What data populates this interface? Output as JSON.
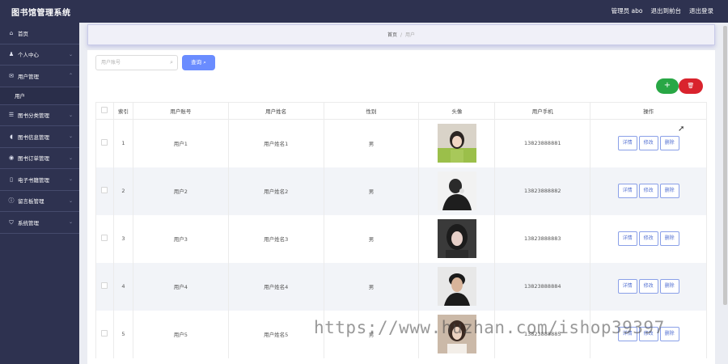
{
  "app": {
    "title": "图书馆管理系统"
  },
  "topbar": {
    "user": "管理员 abo",
    "back": "退出到前台",
    "logout": "退出登录"
  },
  "sidebar": {
    "items": [
      {
        "label": "首页",
        "icon": "home-icon",
        "glyph": "⌂",
        "chevron": false
      },
      {
        "label": "个人中心",
        "icon": "user-icon",
        "glyph": "♟",
        "chevron": true
      },
      {
        "label": "用户管理",
        "icon": "mail-icon",
        "glyph": "✉",
        "chevron": true
      },
      {
        "label": "图书分类管理",
        "icon": "list-icon",
        "glyph": "☰",
        "chevron": true
      },
      {
        "label": "图书信息管理",
        "icon": "mic-icon",
        "glyph": "◖",
        "chevron": true
      },
      {
        "label": "图书订单管理",
        "icon": "order-icon",
        "glyph": "◉",
        "chevron": true
      },
      {
        "label": "电子书籍管理",
        "icon": "phone-icon",
        "glyph": "▯",
        "chevron": true
      },
      {
        "label": "留言板管理",
        "icon": "info-icon",
        "glyph": "ⓘ",
        "chevron": true
      },
      {
        "label": "系统管理",
        "icon": "shield-icon",
        "glyph": "⛉",
        "chevron": true
      }
    ],
    "sub_item": "用户"
  },
  "breadcrumb": {
    "home": "首页",
    "sep": "/",
    "current": "用户"
  },
  "search": {
    "placeholder": "用户账号",
    "button": "查询"
  },
  "table": {
    "headers": [
      "",
      "索引",
      "用户账号",
      "用户姓名",
      "性别",
      "头像",
      "用户手机",
      "操作"
    ],
    "rows": [
      {
        "index": "1",
        "account": "用户1",
        "name": "用户姓名1",
        "gender": "男",
        "phone": "13823888881"
      },
      {
        "index": "2",
        "account": "用户2",
        "name": "用户姓名2",
        "gender": "男",
        "phone": "13823888882"
      },
      {
        "index": "3",
        "account": "用户3",
        "name": "用户姓名3",
        "gender": "男",
        "phone": "13823888883"
      },
      {
        "index": "4",
        "account": "用户4",
        "name": "用户姓名4",
        "gender": "男",
        "phone": "13823888884"
      },
      {
        "index": "5",
        "account": "用户5",
        "name": "用户姓名5",
        "gender": "男",
        "phone": "13823888885"
      }
    ],
    "actions": {
      "detail": "详情",
      "edit": "修改",
      "delete": "删除"
    }
  },
  "buttons": {
    "add": "+",
    "delete": "🗑"
  },
  "watermark": "https://www.huzhan.com/ishop39397",
  "colors": {
    "sidebar": "#2e3250",
    "primary": "#6a8cff",
    "add": "#28a745",
    "delete": "#d9232d"
  }
}
